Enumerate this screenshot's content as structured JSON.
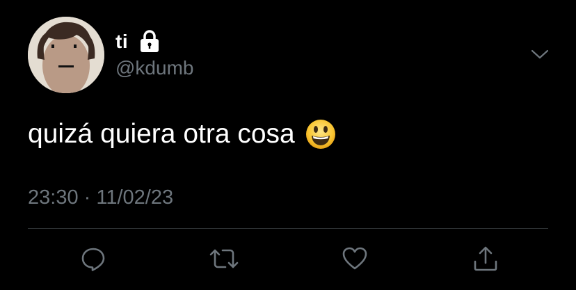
{
  "tweet": {
    "display_name": "ti",
    "handle": "@kdumb",
    "text": "quizá quiera otra cosa",
    "timestamp": "23:30 · 11/02/23",
    "protected_icon": "lock-icon",
    "emoji": "smiling-face-icon"
  },
  "actions": [
    {
      "name": "reply",
      "icon": "reply-icon"
    },
    {
      "name": "retweet",
      "icon": "retweet-icon"
    },
    {
      "name": "like",
      "icon": "heart-icon"
    },
    {
      "name": "share",
      "icon": "share-icon"
    }
  ],
  "colors": {
    "background": "#000000",
    "text_primary": "#ffffff",
    "text_secondary": "#6e767d",
    "divider": "#2f3336"
  }
}
